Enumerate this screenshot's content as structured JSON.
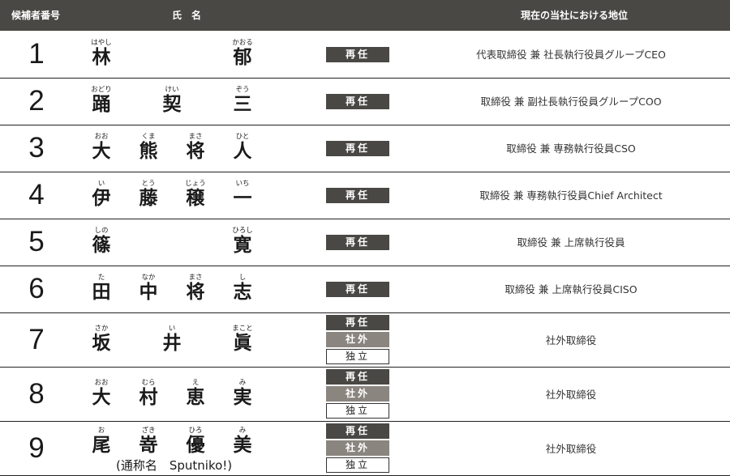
{
  "header": {
    "number_label": "候補者番号",
    "name_label_1": "氏",
    "name_label_2": "名",
    "position_label": "現在の当社における地位"
  },
  "candidates": [
    {
      "number": "1",
      "chars": [
        {
          "kanji": "林",
          "ruby": "はやし"
        },
        {
          "kanji": "郁",
          "ruby": "かおる"
        }
      ],
      "badges": [
        "再任"
      ],
      "position": "代表取締役 兼 社長執行役員グループCEO"
    },
    {
      "number": "2",
      "chars": [
        {
          "kanji": "踊",
          "ruby": "おどり"
        },
        {
          "kanji": "契",
          "ruby": "けい"
        },
        {
          "kanji": "三",
          "ruby": "ぞう"
        }
      ],
      "badges": [
        "再任"
      ],
      "position": "取締役 兼 副社長執行役員グループCOO"
    },
    {
      "number": "3",
      "chars": [
        {
          "kanji": "大",
          "ruby": "おお"
        },
        {
          "kanji": "熊",
          "ruby": "くま"
        },
        {
          "kanji": "将",
          "ruby": "まさ"
        },
        {
          "kanji": "人",
          "ruby": "ひと"
        }
      ],
      "badges": [
        "再任"
      ],
      "position": "取締役 兼 専務執行役員CSO"
    },
    {
      "number": "4",
      "chars": [
        {
          "kanji": "伊",
          "ruby": "い"
        },
        {
          "kanji": "藤",
          "ruby": "とう"
        },
        {
          "kanji": "穣",
          "ruby": "じょう"
        },
        {
          "kanji": "一",
          "ruby": "いち"
        }
      ],
      "badges": [
        "再任"
      ],
      "position": "取締役 兼 専務執行役員Chief Architect"
    },
    {
      "number": "5",
      "chars": [
        {
          "kanji": "篠",
          "ruby": "しの"
        },
        {
          "kanji": "寛",
          "ruby": "ひろし"
        }
      ],
      "badges": [
        "再任"
      ],
      "position": "取締役 兼 上席執行役員"
    },
    {
      "number": "6",
      "chars": [
        {
          "kanji": "田",
          "ruby": "た"
        },
        {
          "kanji": "中",
          "ruby": "なか"
        },
        {
          "kanji": "将",
          "ruby": "まさ"
        },
        {
          "kanji": "志",
          "ruby": "し"
        }
      ],
      "badges": [
        "再任"
      ],
      "position": "取締役 兼 上席執行役員CISO"
    },
    {
      "number": "7",
      "chars": [
        {
          "kanji": "坂",
          "ruby": "さか"
        },
        {
          "kanji": "井",
          "ruby": "い"
        },
        {
          "kanji": "眞",
          "ruby": "まこと"
        }
      ],
      "badges": [
        "再任",
        "社外",
        "独立"
      ],
      "position": "社外取締役"
    },
    {
      "number": "8",
      "chars": [
        {
          "kanji": "大",
          "ruby": "おお"
        },
        {
          "kanji": "村",
          "ruby": "むら"
        },
        {
          "kanji": "恵",
          "ruby": "え"
        },
        {
          "kanji": "実",
          "ruby": "み"
        }
      ],
      "badges": [
        "再任",
        "社外",
        "独立"
      ],
      "position": "社外取締役"
    },
    {
      "number": "9",
      "chars": [
        {
          "kanji": "尾",
          "ruby": "お"
        },
        {
          "kanji": "嵜",
          "ruby": "ざき"
        },
        {
          "kanji": "優",
          "ruby": "ひろ"
        },
        {
          "kanji": "美",
          "ruby": "み"
        }
      ],
      "alias": "(通称名　Sputniko!)",
      "badges": [
        "再任",
        "社外",
        "独立"
      ],
      "position": "社外取締役"
    }
  ],
  "colors": {
    "header_bg": "#4a4844",
    "badge_reappoint": "#4a4844",
    "badge_outside": "#8b8580",
    "badge_independent_border": "#333333"
  }
}
